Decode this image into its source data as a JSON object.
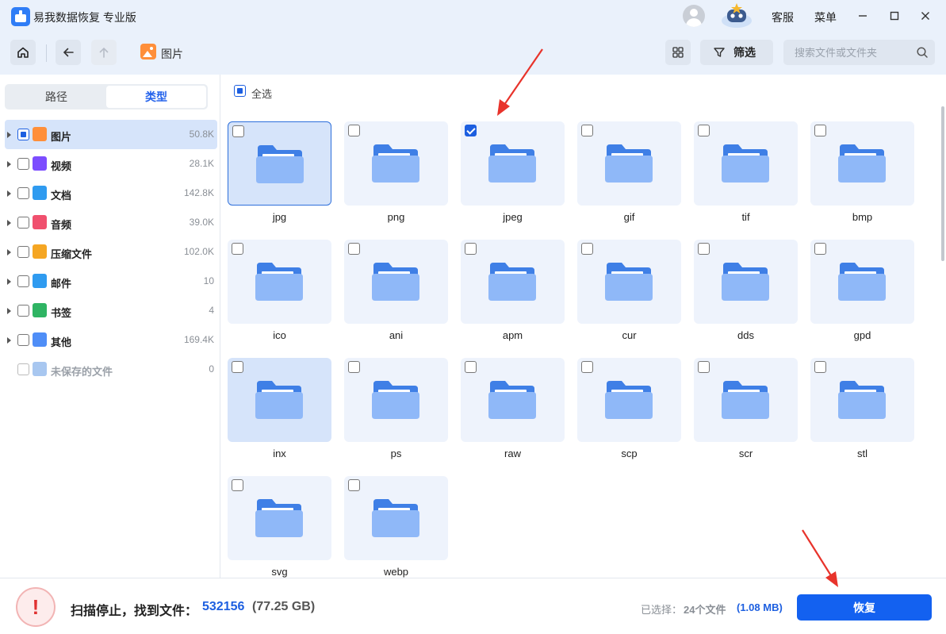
{
  "app": {
    "title": "易我数据恢复 专业版",
    "customer_service": "客服",
    "menu": "菜单"
  },
  "toolbar": {
    "breadcrumb": "图片",
    "filter_label": "筛选",
    "search_placeholder": "搜索文件或文件夹"
  },
  "sidebar": {
    "tabs": [
      "路径",
      "类型"
    ],
    "active_tab": "类型",
    "categories": [
      {
        "label": "图片",
        "count": "50.8K",
        "state": "partial",
        "color": "#ff8f3a",
        "icon": "image-icon"
      },
      {
        "label": "视频",
        "count": "28.1K",
        "state": "unchecked",
        "color": "#7c4dff",
        "icon": "video-icon"
      },
      {
        "label": "文档",
        "count": "142.8K",
        "state": "unchecked",
        "color": "#2f9bf0",
        "icon": "document-icon"
      },
      {
        "label": "音频",
        "count": "39.0K",
        "state": "unchecked",
        "color": "#f0506e",
        "icon": "audio-icon"
      },
      {
        "label": "压缩文件",
        "count": "102.0K",
        "state": "unchecked",
        "color": "#f5a623",
        "icon": "archive-icon"
      },
      {
        "label": "邮件",
        "count": "10",
        "state": "unchecked",
        "color": "#2f9bf0",
        "icon": "mail-icon"
      },
      {
        "label": "书签",
        "count": "4",
        "state": "unchecked",
        "color": "#2fb463",
        "icon": "bookmark-icon"
      },
      {
        "label": "其他",
        "count": "169.4K",
        "state": "unchecked",
        "color": "#4f8ef7",
        "icon": "other-folder-icon"
      },
      {
        "label": "未保存的文件",
        "count": "0",
        "state": "disabled",
        "color": "#a8c7f0",
        "icon": "unsaved-file-icon"
      }
    ]
  },
  "main": {
    "select_all": "全选",
    "items": [
      {
        "label": "jpg",
        "checked": false,
        "style": "sel"
      },
      {
        "label": "png",
        "checked": false,
        "style": ""
      },
      {
        "label": "jpeg",
        "checked": true,
        "style": ""
      },
      {
        "label": "gif",
        "checked": false,
        "style": ""
      },
      {
        "label": "tif",
        "checked": false,
        "style": ""
      },
      {
        "label": "bmp",
        "checked": false,
        "style": ""
      },
      {
        "label": "ico",
        "checked": false,
        "style": ""
      },
      {
        "label": "ani",
        "checked": false,
        "style": ""
      },
      {
        "label": "apm",
        "checked": false,
        "style": ""
      },
      {
        "label": "cur",
        "checked": false,
        "style": ""
      },
      {
        "label": "dds",
        "checked": false,
        "style": ""
      },
      {
        "label": "gpd",
        "checked": false,
        "style": ""
      },
      {
        "label": "inx",
        "checked": false,
        "style": "hov"
      },
      {
        "label": "ps",
        "checked": false,
        "style": ""
      },
      {
        "label": "raw",
        "checked": false,
        "style": ""
      },
      {
        "label": "scp",
        "checked": false,
        "style": ""
      },
      {
        "label": "scr",
        "checked": false,
        "style": ""
      },
      {
        "label": "stl",
        "checked": false,
        "style": ""
      },
      {
        "label": "svg",
        "checked": false,
        "style": ""
      },
      {
        "label": "webp",
        "checked": false,
        "style": ""
      }
    ]
  },
  "footer": {
    "status_text": "扫描停止，找到文件：",
    "found_count": "532156",
    "found_size": "(77.25 GB)",
    "selected_label": "已选择：",
    "selected_count": "24个文件",
    "selected_size": "(1.08 MB)",
    "recover_label": "恢复"
  },
  "colors": {
    "accent": "#1361f0",
    "folder_back": "#3f7fe6",
    "folder_front": "#8fb8f8",
    "annotation": "#e8332b"
  }
}
